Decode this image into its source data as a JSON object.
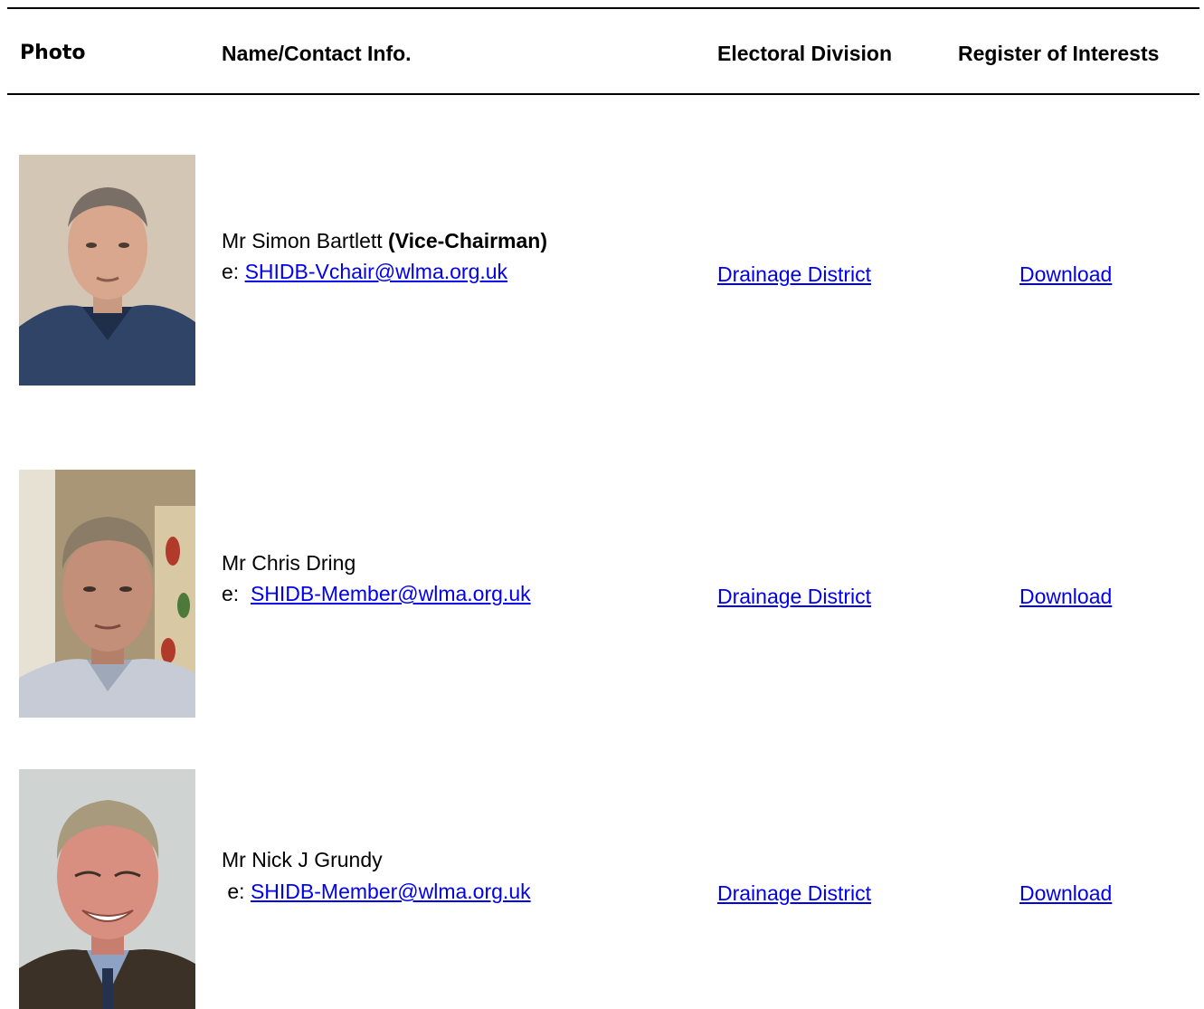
{
  "table": {
    "headers": {
      "photo": "Photo",
      "name": "Name/Contact Info.",
      "division": "Electoral Division",
      "interests": "Register of Interests"
    },
    "members": [
      {
        "name": "Mr Simon Bartlett",
        "role": "(Vice-Chairman)",
        "email_prefix": "e: ",
        "email": "SHIDB-Vchair@wlma.org.uk",
        "division": "Drainage District",
        "interests": "Download",
        "photo_icon": "portrait-photo"
      },
      {
        "name": "Mr Chris Dring",
        "role": "",
        "email_prefix": "e:  ",
        "email": "SHIDB-Member@wlma.org.uk",
        "division": "Drainage District",
        "interests": "Download",
        "photo_icon": "portrait-photo"
      },
      {
        "name": "Mr Nick J Grundy",
        "role": "",
        "email_prefix": " e: ",
        "email": "SHIDB-Member@wlma.org.uk",
        "division": "Drainage District",
        "interests": "Download",
        "photo_icon": "portrait-photo"
      }
    ]
  },
  "colors": {
    "link": "#0000ee",
    "text": "#000000",
    "rule": "#000000"
  }
}
